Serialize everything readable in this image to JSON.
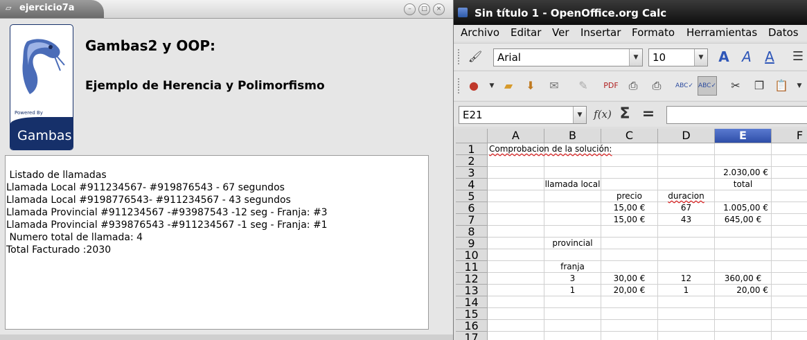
{
  "gambas_window": {
    "title": "ejercicio7a",
    "logo": {
      "powered_by": "Powered By",
      "name": "Gambas"
    },
    "heading": "Gambas2 y OOP:",
    "subheading": "Ejemplo de Herencia y Polimorfismo",
    "output_lines": [
      " Listado de llamadas",
      "Llamada Local #911234567- #919876543 - 67 segundos",
      "Llamada Local #9198776543- #911234567 - 43 segundos",
      "Llamada Provincial #911234567 -#93987543 -12 seg - Franja: #3",
      "Llamada Provincial #939876543 -#911234567 -1 seg - Franja: #1",
      " Numero total de llamada: 4",
      "Total Facturado :2030"
    ]
  },
  "calc_window": {
    "title": "Sin título 1 - OpenOffice.org Calc",
    "menu": [
      "Archivo",
      "Editar",
      "Ver",
      "Insertar",
      "Formato",
      "Herramientas",
      "Datos"
    ],
    "font_name": "Arial",
    "font_size": "10",
    "name_box": "E21",
    "formula_value": "",
    "columns": [
      "A",
      "B",
      "C",
      "D",
      "E",
      "F"
    ],
    "selected_column": "E",
    "rows": [
      "1",
      "2",
      "3",
      "4",
      "5",
      "6",
      "7",
      "8",
      "9",
      "10",
      "11",
      "12",
      "13",
      "14",
      "15",
      "16",
      "17"
    ],
    "cells": {
      "A1": "Comprobacion de la solución:",
      "E3": "2.030,00 €",
      "B4": "llamada local",
      "E4": "total",
      "C5": "precio",
      "D5": "duracion",
      "C6": "15,00 €",
      "D6": "67",
      "E6": "1.005,00 €",
      "C7": "15,00 €",
      "D7": "43",
      "E7": "645,00 €",
      "B9": "provincial",
      "B11": "franja",
      "B12": "3",
      "C12": "30,00 €",
      "D12": "12",
      "E12": "360,00 €",
      "B13": "1",
      "C13": "20,00 €",
      "D13": "1",
      "E13": "20,00 €"
    }
  }
}
